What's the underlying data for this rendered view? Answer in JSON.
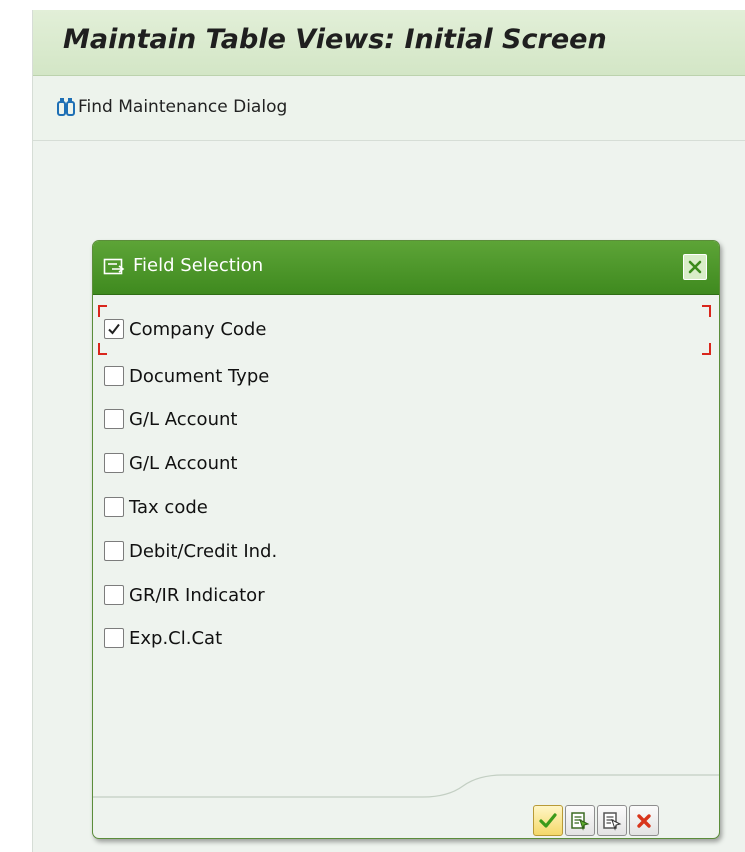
{
  "header": {
    "title": "Maintain Table Views: Initial Screen"
  },
  "toolbar": {
    "find_label": "Find Maintenance Dialog",
    "find_icon": "binoculars-icon"
  },
  "dialog": {
    "title": "Field Selection",
    "title_icon": "field-selection-icon",
    "close_icon": "close-icon",
    "fields": [
      {
        "label": "Company Code",
        "checked": true
      },
      {
        "label": "Document Type",
        "checked": false
      },
      {
        "label": "G/L Account",
        "checked": false
      },
      {
        "label": "G/L Account",
        "checked": false
      },
      {
        "label": "Tax code",
        "checked": false
      },
      {
        "label": "Debit/Credit Ind.",
        "checked": false
      },
      {
        "label": "GR/IR Indicator",
        "checked": false
      },
      {
        "label": "Exp.Cl.Cat",
        "checked": false
      }
    ],
    "footer_buttons": [
      "continue-icon",
      "select-all-icon",
      "deselect-all-icon",
      "cancel-icon"
    ]
  },
  "colors": {
    "header_green": "#4a9527",
    "title_bar": "#d9eacd",
    "focus_red": "#d9261c"
  }
}
